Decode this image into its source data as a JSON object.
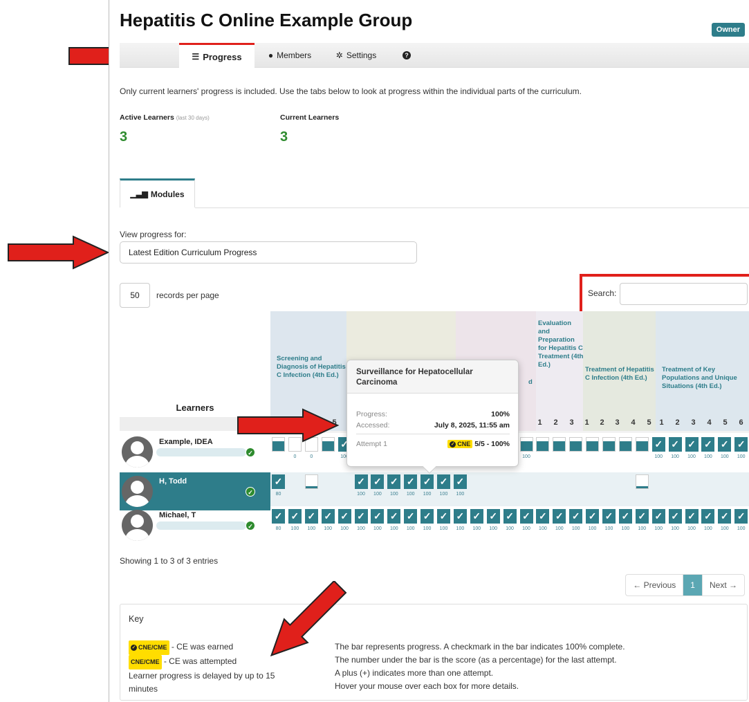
{
  "page": {
    "title": "Hepatitis C Online Example Group",
    "owner_badge": "Owner"
  },
  "tabs": [
    {
      "label": "Progress",
      "icon": "list-icon",
      "active": true
    },
    {
      "label": "Members",
      "icon": "user-icon"
    },
    {
      "label": "Settings",
      "icon": "gear-icon"
    },
    {
      "label": "",
      "icon": "question-icon"
    }
  ],
  "intro": "Only current learners' progress is included. Use the tabs below to look at progress within the individual parts of the curriculum.",
  "stats": {
    "active_label": "Active Learners",
    "active_sub": "(last 30 days)",
    "active_value": "3",
    "current_label": "Current Learners",
    "current_value": "3"
  },
  "module_tab": "Modules",
  "view": {
    "label": "View progress for:",
    "selected": "Latest Edition Curriculum Progress"
  },
  "records": {
    "per_page_value": "50",
    "per_page_label": "records per page",
    "search_label": "Search:"
  },
  "table": {
    "learners_header": "Learners",
    "modules": [
      {
        "title": "Screening and Diagnosis of Hepatitis C Infection (4th Ed.)",
        "color": "#dde6ee"
      },
      {
        "title": "",
        "color": "#ebebdf"
      },
      {
        "title": "",
        "color": "#ede4ea"
      },
      {
        "title": "Evaluation and Preparation for Hepatitis C Treatment (4th Ed.)",
        "color": "#eeebf1"
      },
      {
        "title": "Treatment of Hepatitis C Infection (4th Ed.)",
        "color": "#e5e9df"
      },
      {
        "title": "Treatment of Key Populations and Unique Situations (4th Ed.)",
        "color": "#dde7ee"
      }
    ],
    "visible_column_numbers": [
      "5",
      "5",
      "1",
      "2",
      "3",
      "1",
      "2",
      "3",
      "4",
      "5",
      "1",
      "2",
      "3",
      "4",
      "5",
      "6"
    ],
    "partial_module_suffix": "d",
    "learners": [
      {
        "name": "Example, IDEA",
        "selected": false
      },
      {
        "name": "H, Todd",
        "selected": true
      },
      {
        "name": "Michael, T",
        "selected": false
      }
    ]
  },
  "tooltip": {
    "title": "Surveillance for Hepatocellular Carcinoma",
    "progress_label": "Progress:",
    "progress_value": "100%",
    "accessed_label": "Accessed:",
    "accessed_value": "July 8, 2025, 11:55 am",
    "attempt_label": "Attempt 1",
    "attempt_badge": "CNE",
    "attempt_value": "5/5 - 100%"
  },
  "footer": {
    "showing": "Showing 1 to 3 of 3 entries",
    "prev": "← Previous",
    "page": "1",
    "next": "Next →"
  },
  "key": {
    "title": "Key",
    "earned_badge": "CNE/CME",
    "earned_text": " - CE was earned",
    "attempted_badge": "CNE/CME",
    "attempted_text": " - CE was attempted",
    "delay_text": "Learner progress is delayed by up to 15 minutes",
    "lines": [
      "The bar represents progress. A checkmark in the bar indicates 100% complete.",
      "The number under the bar is the score (as a percentage) for the last attempt.",
      "A plus (+) indicates more than one attempt.",
      "Hover your mouse over each box for more details."
    ]
  },
  "colors": {
    "teal": "#2e7d8a",
    "red_arrow": "#e0201b",
    "green": "#2e8b2e",
    "cne_yellow": "#ffdd00"
  }
}
